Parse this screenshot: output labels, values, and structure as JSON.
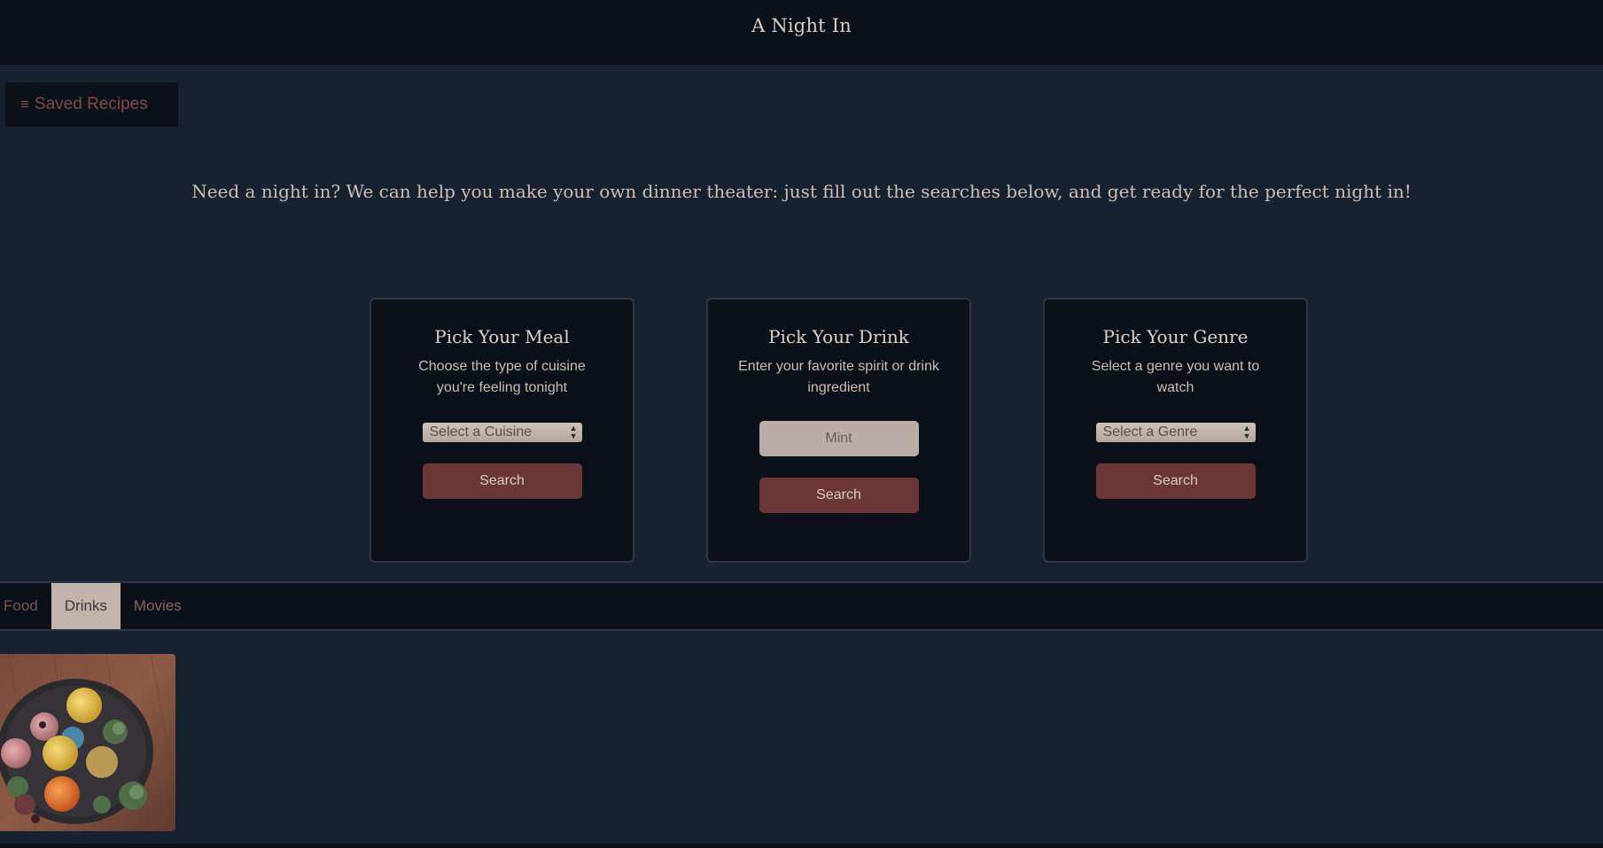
{
  "header": {
    "title": "A Night In"
  },
  "saved_recipes": {
    "icon": "menu-icon",
    "label": "Saved Recipes"
  },
  "intro_text": "Need a night in? We can help you make your own dinner theater: just fill out the searches below, and get ready for the perfect night in!",
  "cards": {
    "meal": {
      "title": "Pick Your Meal",
      "description": "Choose the type of cuisine you're feeling tonight",
      "select_value": "Select a Cuisine",
      "button": "Search"
    },
    "drink": {
      "title": "Pick Your Drink",
      "description": "Enter your favorite spirit or drink ingredient",
      "input_value": "Mint",
      "button": "Search"
    },
    "genre": {
      "title": "Pick Your Genre",
      "description": "Select a genre you want to watch",
      "select_value": "Select a Genre",
      "button": "Search"
    }
  },
  "tabs": [
    {
      "label": "Food",
      "active": false
    },
    {
      "label": "Drinks",
      "active": true
    },
    {
      "label": "Movies",
      "active": false
    }
  ],
  "colors": {
    "background": "#172130",
    "header": "#0b1019",
    "accent_button": "#6a3636",
    "active_tab": "#c2b4ab"
  }
}
